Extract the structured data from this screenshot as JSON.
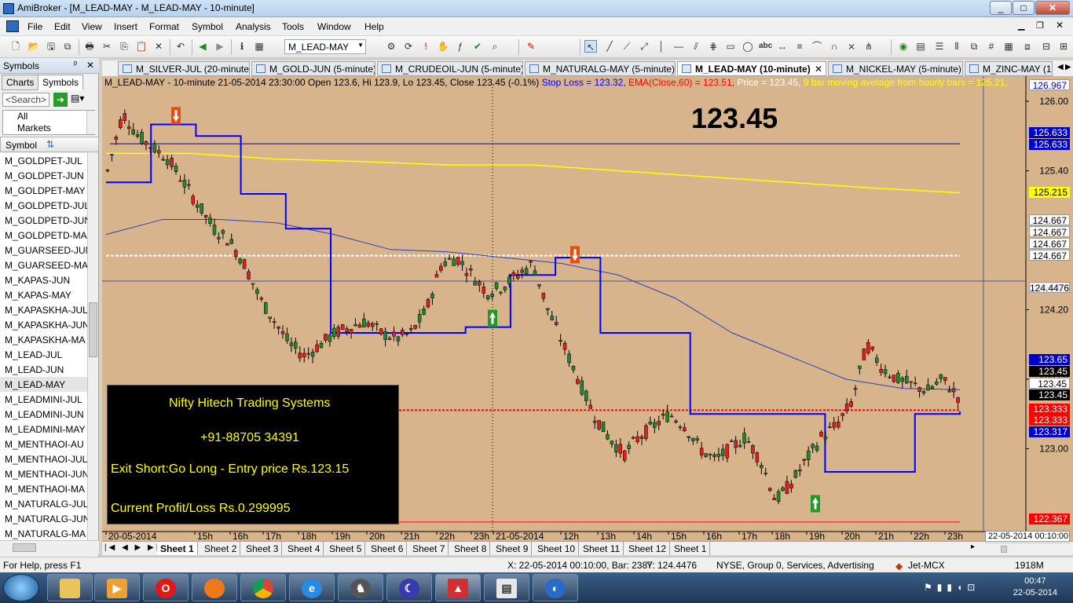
{
  "window": {
    "title": "AmiBroker - [M_LEAD-MAY - M_LEAD-MAY - 10-minute]",
    "controls": [
      "_",
      "□",
      "✕"
    ]
  },
  "menu": [
    "File",
    "Edit",
    "View",
    "Insert",
    "Format",
    "Symbol",
    "Analysis",
    "Tools",
    "Window",
    "Help"
  ],
  "toolbar": {
    "symbol_combo": "M_LEAD-MAY"
  },
  "sidebar": {
    "title": "Symbols",
    "pin": "ᵖ",
    "close": "✕",
    "tabs": [
      "Charts",
      "Symbols"
    ],
    "search_placeholder": "<Search>",
    "tree": [
      "All",
      "Markets"
    ],
    "list_header": "Symbol",
    "symbols": [
      "M_GOLDPET-JUL",
      "M_GOLDPET-JUN",
      "M_GOLDPET-MAY",
      "M_GOLDPETD-JUL",
      "M_GOLDPETD-JUN",
      "M_GOLDPETD-MA",
      "M_GUARSEED-JUN",
      "M_GUARSEED-MAY",
      "M_KAPAS-JUN",
      "M_KAPAS-MAY",
      "M_KAPASKHA-JUL",
      "M_KAPASKHA-JUN",
      "M_KAPASKHA-MA",
      "M_LEAD-JUL",
      "M_LEAD-JUN",
      "M_LEAD-MAY",
      "M_LEADMINI-JUL",
      "M_LEADMINI-JUN",
      "M_LEADMINI-MAY",
      "M_MENTHAOI-AU",
      "M_MENTHAOI-JUL",
      "M_MENTHAOI-JUN",
      "M_MENTHAOI-MA",
      "M_NATURALG-JUL",
      "M_NATURALG-JUN",
      "M_NATURALG-MA"
    ],
    "selected": "M_LEAD-MAY"
  },
  "chart_tabs": [
    {
      "label": "M_SILVER-JUL (20-minute)",
      "active": false
    },
    {
      "label": "M_GOLD-JUN (5-minute)",
      "active": false
    },
    {
      "label": "M_CRUDEOIL-JUN (5-minute)",
      "active": false
    },
    {
      "label": "M_NATURALG-MAY (5-minute)",
      "active": false
    },
    {
      "label": "M_LEAD-MAY (10-minute)",
      "active": true
    },
    {
      "label": "M_NICKEL-MAY (5-minute)",
      "active": false
    },
    {
      "label": "M_ZINC-MAY (1",
      "active": false
    }
  ],
  "chart_header": {
    "main": "M_LEAD-MAY - 10-minute 21-05-2014 23:30:00 Open 123.6, Hi 123.9, Lo 123.45, Close 123.45 (-0.1%)",
    "stop_loss": "Stop Loss = 123.32,",
    "ema": "EMA(Close,60) = 123.51,",
    "price": "Price = 123.45,",
    "ma9": "9 bar moving average from hourly bars = 125.21,"
  },
  "big_price": "123.45",
  "info_box": {
    "line1": "Nifty Hitech Trading Systems",
    "line2": "+91-88705 34391",
    "line3": "Exit Short:Go Long - Entry price Rs.123.15",
    "line4": "Current Profit/Loss Rs.0.299995"
  },
  "colors": {
    "chart_bg": "#d8b48c",
    "stop_loss": "#0000ff",
    "ema": "#2b3fbf",
    "ma9": "#ffff00",
    "bull": "#1f8a2a",
    "bear": "#e02020",
    "white_level": "#ffffff",
    "red_level": "#ff0000"
  },
  "price_axis": {
    "ticks": [
      "126.00",
      "125.40",
      "124.20",
      "123.60",
      "123.00"
    ],
    "labels": [
      {
        "text": "126.967",
        "bg": "#ffffff",
        "fg": "#0000cc"
      },
      {
        "text": "125.633",
        "bg": "#0000cc",
        "fg": "#ffffff"
      },
      {
        "text": "125.633",
        "bg": "#0000cc",
        "fg": "#ffffff"
      },
      {
        "text": "125.215",
        "bg": "#ffff00",
        "fg": "#000000"
      },
      {
        "text": "124.667",
        "bg": "#ffffff",
        "fg": "#000000"
      },
      {
        "text": "124.667",
        "bg": "#ffffff",
        "fg": "#000000"
      },
      {
        "text": "124.667",
        "bg": "#ffffff",
        "fg": "#000000"
      },
      {
        "text": "124.667",
        "bg": "#ffffff",
        "fg": "#000000"
      },
      {
        "text": "124.4476",
        "bg": "#f0f0f0",
        "fg": "#000000"
      },
      {
        "text": "123.65",
        "bg": "#0000cc",
        "fg": "#ffffff"
      },
      {
        "text": "123.45",
        "bg": "#000000",
        "fg": "#ffffff"
      },
      {
        "text": "123.45",
        "bg": "#ffffff",
        "fg": "#000000"
      },
      {
        "text": "123.45",
        "bg": "#000000",
        "fg": "#ffffff"
      },
      {
        "text": "123.333",
        "bg": "#ff0000",
        "fg": "#ffffff"
      },
      {
        "text": "123.333",
        "bg": "#ff0000",
        "fg": "#ffffff"
      },
      {
        "text": "123.317",
        "bg": "#0000cc",
        "fg": "#ffffff"
      },
      {
        "text": "122.367",
        "bg": "#ff0000",
        "fg": "#ffffff"
      }
    ]
  },
  "time_axis": [
    "20-05-2014",
    "15h",
    "16h",
    "17h",
    "18h",
    "19h",
    "20h",
    "21h",
    "22h",
    "23h",
    "21-05-2014",
    "12h",
    "13h",
    "14h",
    "15h",
    "16h",
    "17h",
    "18h",
    "19h",
    "20h",
    "21h",
    "22h",
    "23h"
  ],
  "cursor_time": "22-05-2014 00:10:00",
  "chart_data": {
    "type": "line",
    "title": "M_LEAD-MAY - 10-minute",
    "ylim": [
      122.3,
      126.3
    ],
    "series": [
      {
        "name": "Stop Loss",
        "values": [
          125.3,
          125.8,
          125.7,
          125.2,
          124.9,
          124.0,
          124.0,
          124.0,
          124.05,
          124.5,
          124.65,
          124.0,
          124.0,
          123.3,
          123.3,
          123.3,
          122.8,
          122.8,
          123.3,
          123.32
        ]
      },
      {
        "name": "EMA(Close,60)",
        "values": [
          124.85,
          124.98,
          124.98,
          124.95,
          124.85,
          124.72,
          124.7,
          124.65,
          124.6,
          124.5,
          124.3,
          124.0,
          123.8,
          123.6,
          123.52,
          123.51
        ]
      },
      {
        "name": "9 bar moving average from hourly bars",
        "values": [
          125.55,
          125.55,
          125.5,
          125.48,
          125.45,
          125.45,
          125.4,
          125.35,
          125.3,
          125.25,
          125.21
        ]
      }
    ]
  },
  "sheets": [
    "Sheet 1",
    "Sheet 2",
    "Sheet 3",
    "Sheet 4",
    "Sheet 5",
    "Sheet 6",
    "Sheet 7",
    "Sheet 8",
    "Sheet 9",
    "Sheet 10",
    "Sheet 11",
    "Sheet 12",
    "Sheet 1"
  ],
  "status": {
    "help": "For Help, press F1",
    "cursor": "X: 22-05-2014 00:10:00, Bar: 2387",
    "y": "Y: 124.4476",
    "market": "NYSE, Group 0, Services, Advertising",
    "feed": "Jet-MCX",
    "memory": "1918M"
  },
  "taskbar": {
    "time": "00:47",
    "date": "22-05-2014"
  }
}
